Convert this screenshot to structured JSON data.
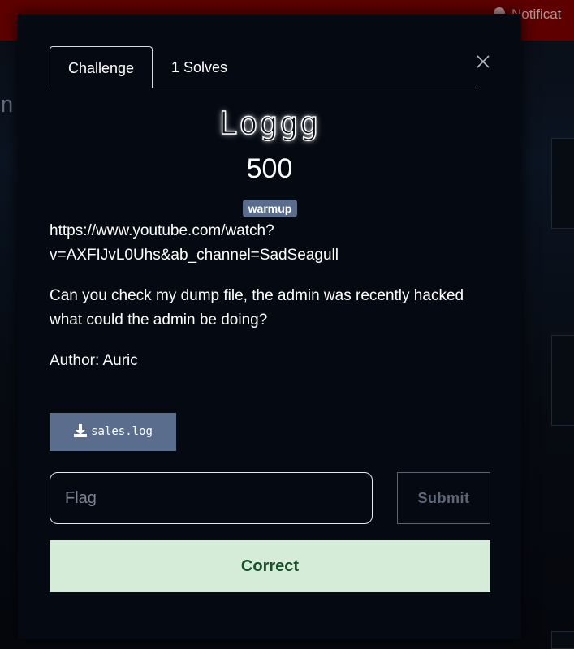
{
  "background": {
    "notification_label": "Notificat",
    "edge_text": "n"
  },
  "modal": {
    "tabs": [
      {
        "label": "Challenge"
      },
      {
        "label": "1 Solves"
      }
    ],
    "close_icon": "close-icon",
    "challenge": {
      "name": "Loggg",
      "points": "500",
      "tag": "warmup",
      "description_link_line1": "https://www.youtube.com/watch?",
      "description_link_line2": "v=AXFIJvL0Uhs&ab_channel=SadSeagull",
      "description_line1": "Can you check my dump file, the admin was recently hacked",
      "description_line2": "what could the admin be doing?",
      "author": "Author: Auric"
    },
    "file": {
      "icon": "download-icon",
      "label": "sales.log"
    },
    "flag_input": {
      "placeholder": "Flag",
      "value": ""
    },
    "submit_label": "Submit",
    "result": "Correct"
  },
  "colors": {
    "topbar": "#5e0000",
    "modal_bg": "#050a12",
    "tag_bg": "#5a6d8c",
    "success_bg": "#d4ecd8",
    "success_text": "#17502a"
  }
}
